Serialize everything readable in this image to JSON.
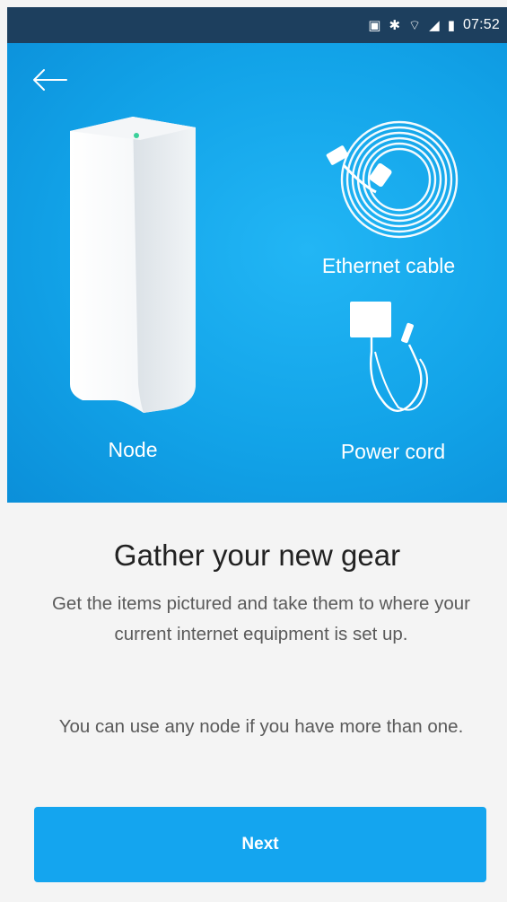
{
  "status_bar": {
    "time": "07:52",
    "icons": [
      "notification-icon",
      "bluetooth-icon",
      "wifi-icon",
      "signal-icon",
      "battery-icon"
    ]
  },
  "hero": {
    "back_icon": "arrow-left-icon",
    "node_label": "Node",
    "ethernet_label": "Ethernet cable",
    "power_label": "Power cord"
  },
  "content": {
    "title": "Gather your new gear",
    "description": "Get the items pictured and take them to where your current internet equipment is set up.",
    "description2": "You can use any node if you have more than one."
  },
  "actions": {
    "next_label": "Next"
  },
  "colors": {
    "status_bar": "#1d3f5e",
    "hero_blue": "#12a3e8",
    "button_blue": "#14a5ef",
    "background": "#f4f4f4"
  }
}
